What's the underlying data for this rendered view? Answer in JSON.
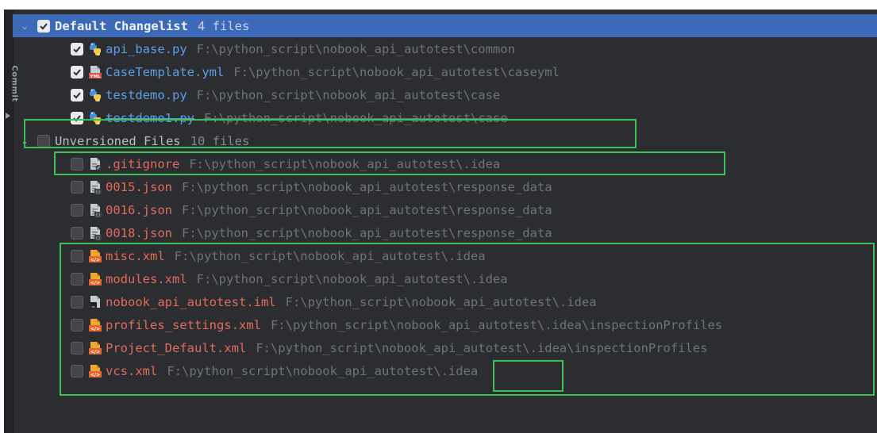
{
  "side_tab": {
    "label": "Commit"
  },
  "default_changelist": {
    "label": "Default Changelist",
    "count": "4 files",
    "items": [
      {
        "name": "api_base.py",
        "path": "F:\\python_script\\nobook_api_autotest\\common",
        "icon": "python-file-icon"
      },
      {
        "name": "CaseTemplate.yml",
        "path": "F:\\python_script\\nobook_api_autotest\\caseyml",
        "icon": "yaml-file-icon"
      },
      {
        "name": "testdemo.py",
        "path": "F:\\python_script\\nobook_api_autotest\\case",
        "icon": "python-file-icon"
      },
      {
        "name": "testdemo1.py",
        "path": "F:\\python_script\\nobook_api_autotest\\case",
        "icon": "python-file-icon"
      }
    ]
  },
  "unversioned": {
    "label": "Unversioned Files",
    "count": "10 files",
    "items": [
      {
        "name": ".gitignore",
        "path": "F:\\python_script\\nobook_api_autotest\\.idea",
        "icon": "gitignore-file-icon"
      },
      {
        "name": "0015.json",
        "path": "F:\\python_script\\nobook_api_autotest\\response_data",
        "icon": "json-file-icon"
      },
      {
        "name": "0016.json",
        "path": "F:\\python_script\\nobook_api_autotest\\response_data",
        "icon": "json-file-icon"
      },
      {
        "name": "0018.json",
        "path": "F:\\python_script\\nobook_api_autotest\\response_data",
        "icon": "json-file-icon"
      },
      {
        "name": "misc.xml",
        "path": "F:\\python_script\\nobook_api_autotest\\.idea",
        "icon": "xml-file-icon"
      },
      {
        "name": "modules.xml",
        "path": "F:\\python_script\\nobook_api_autotest\\.idea",
        "icon": "xml-file-icon"
      },
      {
        "name": "nobook_api_autotest.iml",
        "path": "F:\\python_script\\nobook_api_autotest\\.idea",
        "icon": "iml-file-icon"
      },
      {
        "name": "profiles_settings.xml",
        "path": "F:\\python_script\\nobook_api_autotest\\.idea\\inspectionProfiles",
        "icon": "xml-file-icon"
      },
      {
        "name": "Project_Default.xml",
        "path": "F:\\python_script\\nobook_api_autotest\\.idea\\inspectionProfiles",
        "icon": "xml-file-icon"
      },
      {
        "name": "vcs.xml",
        "path": "F:\\python_script\\nobook_api_autotest\\.idea",
        "icon": "xml-file-icon"
      }
    ]
  },
  "colors": {
    "background": "#2b2d30",
    "selection": "#3d6ab8",
    "modified_file": "#5e9ee6",
    "unversioned_file": "#e26b5c",
    "path": "#6f737a",
    "annotation_box": "#3cc15a"
  }
}
